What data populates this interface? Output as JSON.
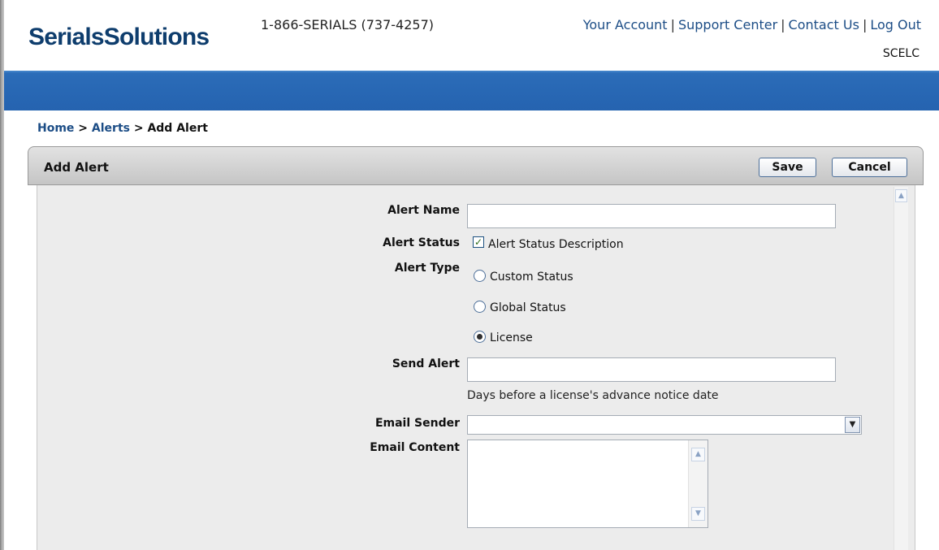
{
  "header": {
    "logo_text": "SerialsSolutions",
    "phone": "1-866-SERIALS (737-4257)",
    "links": [
      "Your Account",
      "Support Center",
      "Contact Us",
      "Log Out"
    ],
    "link_separator": "|",
    "organization": "SCELC"
  },
  "breadcrumb": {
    "home": "Home",
    "alerts": "Alerts",
    "current": "Add Alert",
    "separator": ">"
  },
  "panel": {
    "title": "Add Alert",
    "save_label": "Save",
    "cancel_label": "Cancel"
  },
  "form": {
    "alert_name": {
      "label": "Alert Name",
      "value": ""
    },
    "alert_status": {
      "label": "Alert Status",
      "checkbox_label": "Alert Status Description",
      "checked": true
    },
    "alert_type": {
      "label": "Alert Type",
      "options": [
        {
          "label": "Custom Status",
          "selected": false
        },
        {
          "label": "Global Status",
          "selected": false
        },
        {
          "label": "License",
          "selected": true
        }
      ]
    },
    "send_alert": {
      "label": "Send Alert",
      "value": "",
      "hint": "Days before a license's advance notice date"
    },
    "email_sender": {
      "label": "Email Sender",
      "value": ""
    },
    "email_content": {
      "label": "Email Content",
      "value": ""
    }
  },
  "icons": {
    "checkmark": "check-icon",
    "dropdown": "chevron-down-icon",
    "scroll_up": "scroll-up-icon",
    "scroll_down": "scroll-down-icon"
  },
  "colors": {
    "brand_blue": "#0e3d6d",
    "link_blue": "#1c4d86",
    "bar_blue": "#2563b0",
    "panel_bg": "#ececec"
  }
}
